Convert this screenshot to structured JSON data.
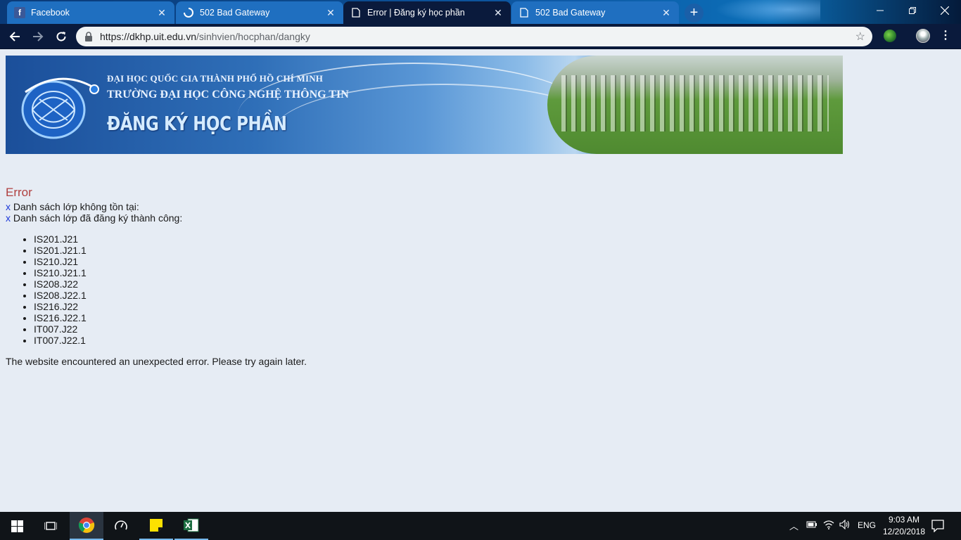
{
  "browser": {
    "tabs": [
      {
        "title": "Facebook",
        "icon": "facebook-icon"
      },
      {
        "title": "502 Bad Gateway",
        "icon": "loading-icon"
      },
      {
        "title": "Error | Đăng ký học phần",
        "icon": "page-icon",
        "active": true
      },
      {
        "title": "502 Bad Gateway",
        "icon": "page-icon"
      }
    ],
    "tab_close_glyph": "✕",
    "new_tab_glyph": "+",
    "url_host": "https://dkhp.uit.edu.vn",
    "url_path": "/sinhvien/hocphan/dangky"
  },
  "banner": {
    "line1": "ĐẠI HỌC QUỐC GIA THÀNH PHỐ HỒ CHÍ MINH",
    "line2": "TRƯỜNG ĐẠI HỌC CÔNG NGHỆ THÔNG TIN",
    "line3": "ĐĂNG KÝ HỌC PHẦN"
  },
  "content": {
    "error_title": "Error",
    "x_glyph": "x",
    "msg1": " Danh sách lớp không tồn tại:",
    "msg2": " Danh sách lớp đã đăng ký thành công:",
    "classes": [
      "IS201.J21",
      "IS201.J21.1",
      "IS210.J21",
      "IS210.J21.1",
      "IS208.J22",
      "IS208.J22.1",
      "IS216.J22",
      "IS216.J22.1",
      "IT007.J22",
      "IT007.J22.1"
    ],
    "footer": "The website encountered an unexpected error. Please try again later."
  },
  "taskbar": {
    "lang": "ENG",
    "time": "9:03 AM",
    "date": "12/20/2018"
  },
  "colors": {
    "error_title": "#b04040",
    "x_mark": "#1a36d8",
    "page_bg": "#e6ecf4"
  }
}
